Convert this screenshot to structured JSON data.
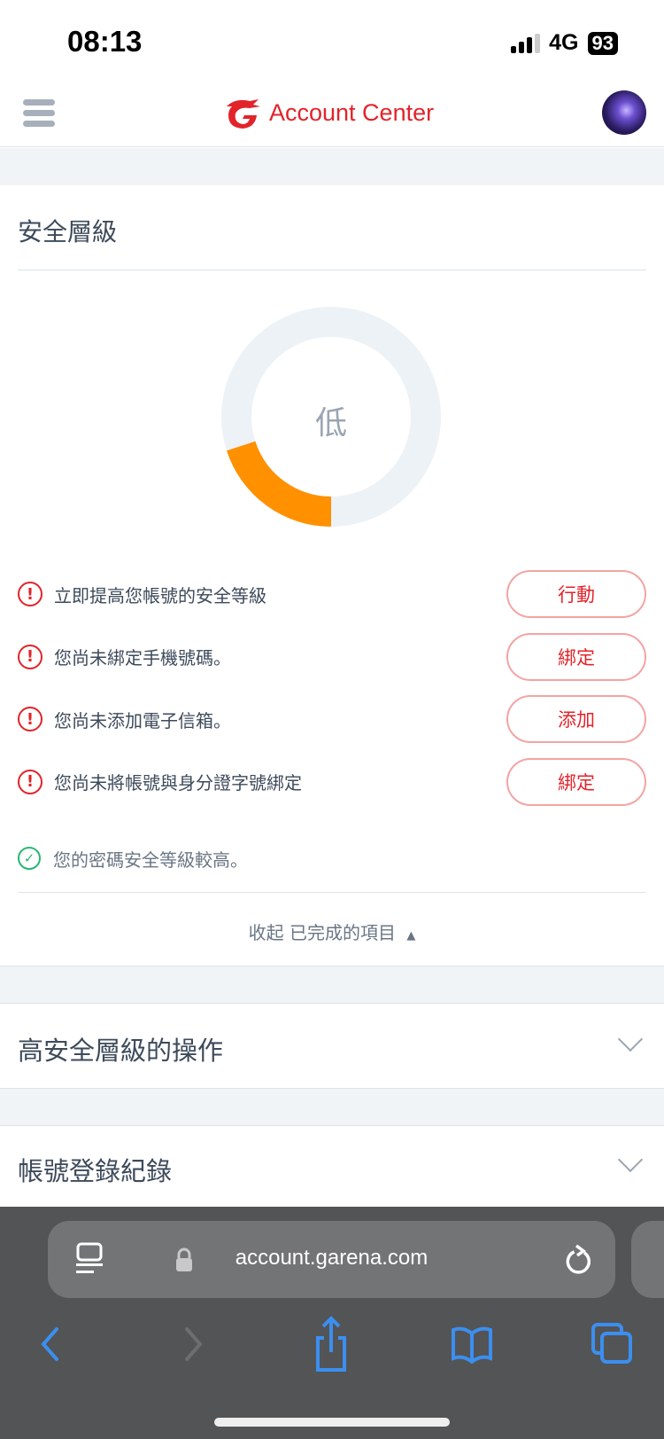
{
  "status_bar": {
    "time": "08:13",
    "network": "4G",
    "battery": "93"
  },
  "header": {
    "title": "Account Center"
  },
  "security": {
    "title": "安全層級",
    "level_label": "低",
    "level_fraction": 0.2,
    "colors": {
      "fill": "#ff9000",
      "track": "#edf2f6",
      "alert": "#e2232a",
      "ok": "#2bb673"
    },
    "items": [
      {
        "text": "立即提高您帳號的安全等級",
        "button": "行動"
      },
      {
        "text": "您尚未綁定手機號碼。",
        "button": "綁定"
      },
      {
        "text": "您尚未添加電子信箱。",
        "button": "添加"
      },
      {
        "text": "您尚未將帳號與身分證字號綁定",
        "button": "綁定"
      }
    ],
    "completed": [
      {
        "text": "您的密碼安全等級較高。"
      }
    ],
    "collapse_label": "收起 已完成的項目"
  },
  "sections": [
    {
      "title": "高安全層級的操作"
    },
    {
      "title": "帳號登錄紀錄"
    }
  ],
  "browser": {
    "url": "account.garena.com"
  }
}
